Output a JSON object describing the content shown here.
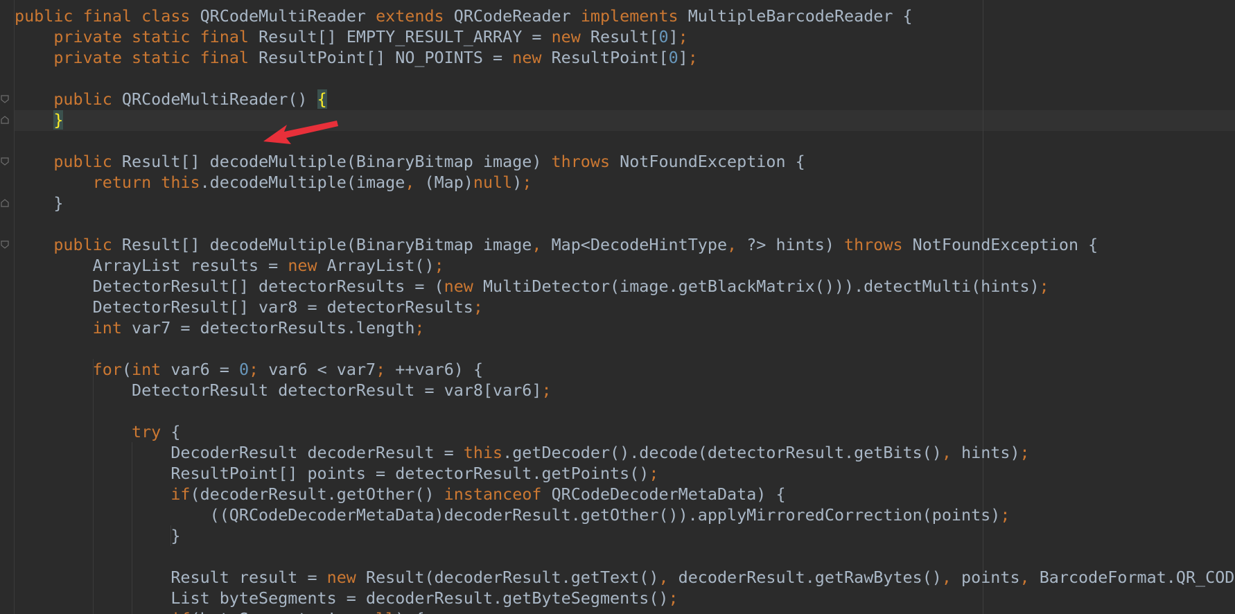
{
  "editor": {
    "background": "#2b2b2b",
    "colors": {
      "text": "#a9b7c6",
      "keyword": "#cc7832",
      "number": "#6897bb",
      "brace_match": "#ffef28",
      "annotation_arrow": "#e8303a"
    },
    "annotation": "red-arrow-pointing-at-empty-constructor",
    "lines": [
      [
        [
          "kw",
          "public final class "
        ],
        [
          "t",
          "QRCodeMultiReader "
        ],
        [
          "kw",
          "extends "
        ],
        [
          "t",
          "QRCodeReader "
        ],
        [
          "kw",
          "implements "
        ],
        [
          "t",
          "MultipleBarcodeReader {"
        ]
      ],
      [
        [
          "t",
          "    "
        ],
        [
          "kw",
          "private static final "
        ],
        [
          "t",
          "Result[] EMPTY_RESULT_ARRAY = "
        ],
        [
          "kw",
          "new "
        ],
        [
          "t",
          "Result["
        ],
        [
          "num",
          "0"
        ],
        [
          "t",
          "]"
        ],
        [
          "kw",
          ";"
        ]
      ],
      [
        [
          "t",
          "    "
        ],
        [
          "kw",
          "private static final "
        ],
        [
          "t",
          "ResultPoint[] NO_POINTS = "
        ],
        [
          "kw",
          "new "
        ],
        [
          "t",
          "ResultPoint["
        ],
        [
          "num",
          "0"
        ],
        [
          "t",
          "]"
        ],
        [
          "kw",
          ";"
        ]
      ],
      [
        [
          "t",
          ""
        ]
      ],
      [
        [
          "t",
          "    "
        ],
        [
          "kw",
          "public "
        ],
        [
          "t",
          "QRCodeMultiReader() "
        ],
        [
          "hl",
          "{"
        ]
      ],
      [
        [
          "t",
          "    "
        ],
        [
          "hl",
          "}"
        ]
      ],
      [
        [
          "t",
          ""
        ]
      ],
      [
        [
          "t",
          "    "
        ],
        [
          "kw",
          "public "
        ],
        [
          "t",
          "Result[] decodeMultiple(BinaryBitmap image) "
        ],
        [
          "kw",
          "throws "
        ],
        [
          "t",
          "NotFoundException {"
        ]
      ],
      [
        [
          "t",
          "        "
        ],
        [
          "kw",
          "return this"
        ],
        [
          "t",
          ".decodeMultiple(image"
        ],
        [
          "kw",
          ", "
        ],
        [
          "t",
          "(Map)"
        ],
        [
          "kw",
          "null"
        ],
        [
          "t",
          ")"
        ],
        [
          "kw",
          ";"
        ]
      ],
      [
        [
          "t",
          "    }"
        ]
      ],
      [
        [
          "t",
          ""
        ]
      ],
      [
        [
          "t",
          "    "
        ],
        [
          "kw",
          "public "
        ],
        [
          "t",
          "Result[] decodeMultiple(BinaryBitmap image"
        ],
        [
          "kw",
          ", "
        ],
        [
          "t",
          "Map<DecodeHintType"
        ],
        [
          "kw",
          ", "
        ],
        [
          "t",
          "?> hints) "
        ],
        [
          "kw",
          "throws "
        ],
        [
          "t",
          "NotFoundException {"
        ]
      ],
      [
        [
          "t",
          "        ArrayList results = "
        ],
        [
          "kw",
          "new "
        ],
        [
          "t",
          "ArrayList()"
        ],
        [
          "kw",
          ";"
        ]
      ],
      [
        [
          "t",
          "        DetectorResult[] detectorResults = ("
        ],
        [
          "kw",
          "new "
        ],
        [
          "t",
          "MultiDetector(image.getBlackMatrix())).detectMulti(hints)"
        ],
        [
          "kw",
          ";"
        ]
      ],
      [
        [
          "t",
          "        DetectorResult[] var8 = detectorResults"
        ],
        [
          "kw",
          ";"
        ]
      ],
      [
        [
          "t",
          "        "
        ],
        [
          "kw",
          "int "
        ],
        [
          "t",
          "var7 = detectorResults.length"
        ],
        [
          "kw",
          ";"
        ]
      ],
      [
        [
          "t",
          ""
        ]
      ],
      [
        [
          "t",
          "        "
        ],
        [
          "kw",
          "for"
        ],
        [
          "t",
          "("
        ],
        [
          "kw",
          "int "
        ],
        [
          "t",
          "var6 = "
        ],
        [
          "num",
          "0"
        ],
        [
          "kw",
          "; "
        ],
        [
          "t",
          "var6 < var7"
        ],
        [
          "kw",
          "; "
        ],
        [
          "t",
          "++var6) {"
        ]
      ],
      [
        [
          "t",
          "            DetectorResult detectorResult = var8[var6]"
        ],
        [
          "kw",
          ";"
        ]
      ],
      [
        [
          "t",
          ""
        ]
      ],
      [
        [
          "t",
          "            "
        ],
        [
          "kw",
          "try "
        ],
        [
          "t",
          "{"
        ]
      ],
      [
        [
          "t",
          "                DecoderResult decoderResult = "
        ],
        [
          "kw",
          "this"
        ],
        [
          "t",
          ".getDecoder().decode(detectorResult.getBits()"
        ],
        [
          "kw",
          ", "
        ],
        [
          "t",
          "hints)"
        ],
        [
          "kw",
          ";"
        ]
      ],
      [
        [
          "t",
          "                ResultPoint[] points = detectorResult.getPoints()"
        ],
        [
          "kw",
          ";"
        ]
      ],
      [
        [
          "t",
          "                "
        ],
        [
          "kw",
          "if"
        ],
        [
          "t",
          "(decoderResult.getOther() "
        ],
        [
          "kw",
          "instanceof "
        ],
        [
          "t",
          "QRCodeDecoderMetaData) {"
        ]
      ],
      [
        [
          "t",
          "                    ((QRCodeDecoderMetaData)decoderResult.getOther()).applyMirroredCorrection(points)"
        ],
        [
          "kw",
          ";"
        ]
      ],
      [
        [
          "t",
          "                }"
        ]
      ],
      [
        [
          "t",
          ""
        ]
      ],
      [
        [
          "t",
          "                Result result = "
        ],
        [
          "kw",
          "new "
        ],
        [
          "t",
          "Result(decoderResult.getText()"
        ],
        [
          "kw",
          ", "
        ],
        [
          "t",
          "decoderResult.getRawBytes()"
        ],
        [
          "kw",
          ", "
        ],
        [
          "t",
          "points"
        ],
        [
          "kw",
          ", "
        ],
        [
          "t",
          "BarcodeFormat.QR_CODE"
        ]
      ],
      [
        [
          "t",
          "                List byteSegments = decoderResult.getByteSegments()"
        ],
        [
          "kw",
          ";"
        ]
      ],
      [
        [
          "t",
          "                "
        ],
        [
          "kw",
          "if"
        ],
        [
          "t",
          "(byteSegments != "
        ],
        [
          "kw",
          "null"
        ],
        [
          "t",
          ") {"
        ]
      ]
    ]
  }
}
